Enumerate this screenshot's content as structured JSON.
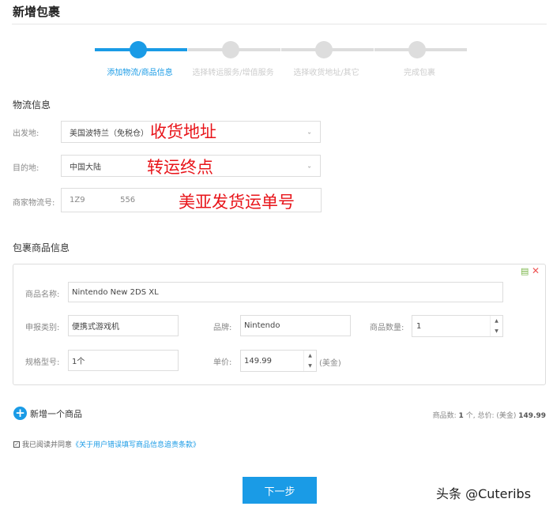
{
  "title": "新增包裹",
  "steps": [
    {
      "label": "添加物流/商品信息",
      "active": true
    },
    {
      "label": "选择转运服务/增值服务",
      "active": false
    },
    {
      "label": "选择收货地址/其它",
      "active": false
    },
    {
      "label": "完成包裹",
      "active": false
    }
  ],
  "logistics": {
    "heading": "物流信息",
    "origin_label": "出发地:",
    "origin_value": "美国波特兰（免税仓）",
    "dest_label": "目的地:",
    "dest_value": "中国大陆",
    "tracking_label": "商家物流号:",
    "tracking_value": "1Z9              556"
  },
  "annotations": {
    "origin": "收货地址",
    "dest": "转运终点",
    "tracking": "美亚发货运单号"
  },
  "goods": {
    "heading": "包裹商品信息",
    "name_label": "商品名称:",
    "name_value": "Nintendo New 2DS XL",
    "category_label": "申报类别:",
    "category_value": "便携式游戏机",
    "brand_label": "品牌:",
    "brand_value": "Nintendo",
    "qty_label": "商品数量:",
    "qty_value": "1",
    "spec_label": "规格型号:",
    "spec_value": "1个",
    "price_label": "单价:",
    "price_value": "149.99",
    "currency": "(美金)"
  },
  "add_item": "新增一个商品",
  "summary": {
    "count_label": "商品数:",
    "count": "1",
    "count_unit": "个,",
    "total_label": "总价:",
    "currency": "(美金)",
    "total": "149.99"
  },
  "agree": {
    "text": "我已阅读并同意",
    "link": "《关于用户错误填写商品信息追责条款》"
  },
  "next_button": "下一步",
  "watermark": "头条 @Cuteribs",
  "colors": {
    "accent": "#1a9be6",
    "annotation": "#e8141a"
  }
}
